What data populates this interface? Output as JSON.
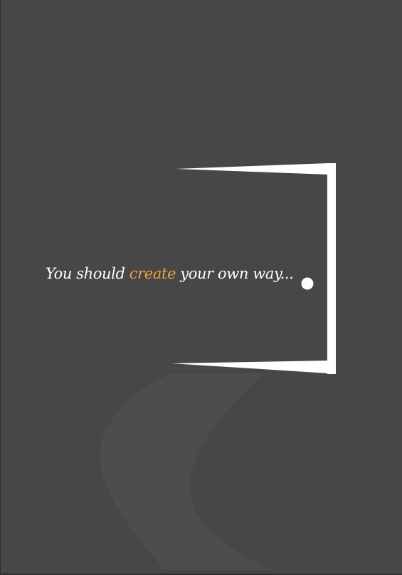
{
  "tagline": {
    "before": "You should ",
    "highlight": "create",
    "after": " your own way..."
  },
  "colors": {
    "background": "#474749",
    "path": "#4d4e50",
    "door": "#ffffff",
    "text": "#ffffff",
    "accent": "#f2a23a"
  },
  "icons": {
    "door": "open-door-icon",
    "path": "winding-path-illustration"
  }
}
